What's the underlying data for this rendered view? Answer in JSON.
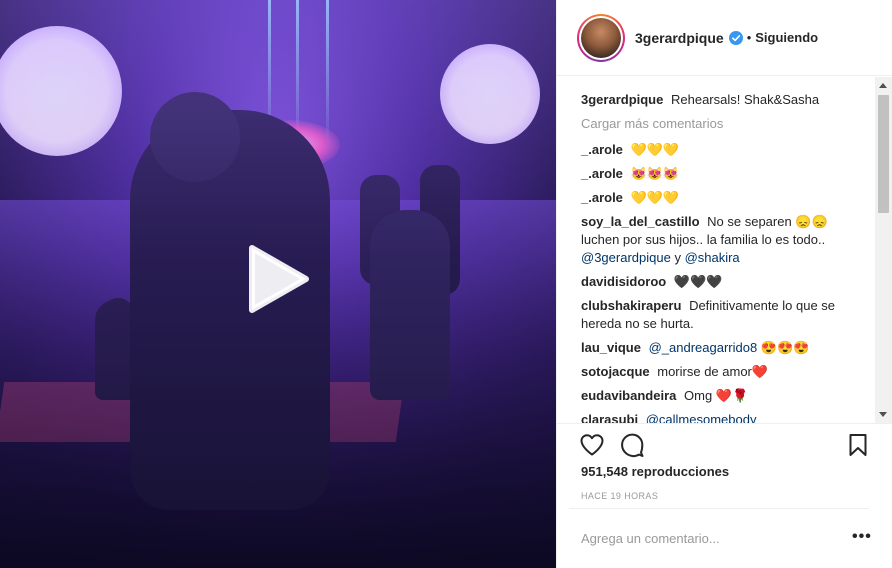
{
  "header": {
    "username": "3gerardpique",
    "separator": "•",
    "follow_status": "Siguiendo"
  },
  "caption": {
    "username": "3gerardpique",
    "text": "Rehearsals! Shak&Sasha"
  },
  "load_more_comments": "Cargar más comentarios",
  "comments": [
    {
      "user": "_.arole",
      "text": "💛💛💛"
    },
    {
      "user": "_.arole",
      "text": "😻😻😻"
    },
    {
      "user": "_.arole",
      "text": "💛💛💛"
    },
    {
      "user": "soy_la_del_castillo",
      "text": "No se separen 😞😞 luchen por sus hijos.. la familia lo es todo..",
      "mention1": "@3gerardpique",
      "joiner": " y ",
      "mention2": "@shakira"
    },
    {
      "user": "davidisidoroo",
      "text": "🖤🖤🖤"
    },
    {
      "user": "clubshakiraperu",
      "text": "Definitivamente lo que se hereda no se hurta."
    },
    {
      "user": "lau_vique",
      "mention": "@_andreagarrido8",
      "text": "😍😍😍"
    },
    {
      "user": "sotojacque",
      "text": "morirse de amor❤️"
    },
    {
      "user": "eudavibandeira",
      "text": "Omg ❤️🌹"
    },
    {
      "user": "clarasubi",
      "mention": "@callmesomebody"
    }
  ],
  "stats": {
    "views": "951,548 reproducciones",
    "time_ago": "HACE 19 HORAS"
  },
  "composer": {
    "placeholder": "Agrega un comentario...",
    "more": "•••"
  },
  "icons": {
    "play": "play-icon",
    "verified": "verified-badge-icon",
    "like": "heart-icon",
    "comment": "comment-bubble-icon",
    "save": "bookmark-icon"
  },
  "colors": {
    "text": "#262626",
    "muted": "#999999",
    "mention": "#003569",
    "verified": "#3897f0"
  }
}
